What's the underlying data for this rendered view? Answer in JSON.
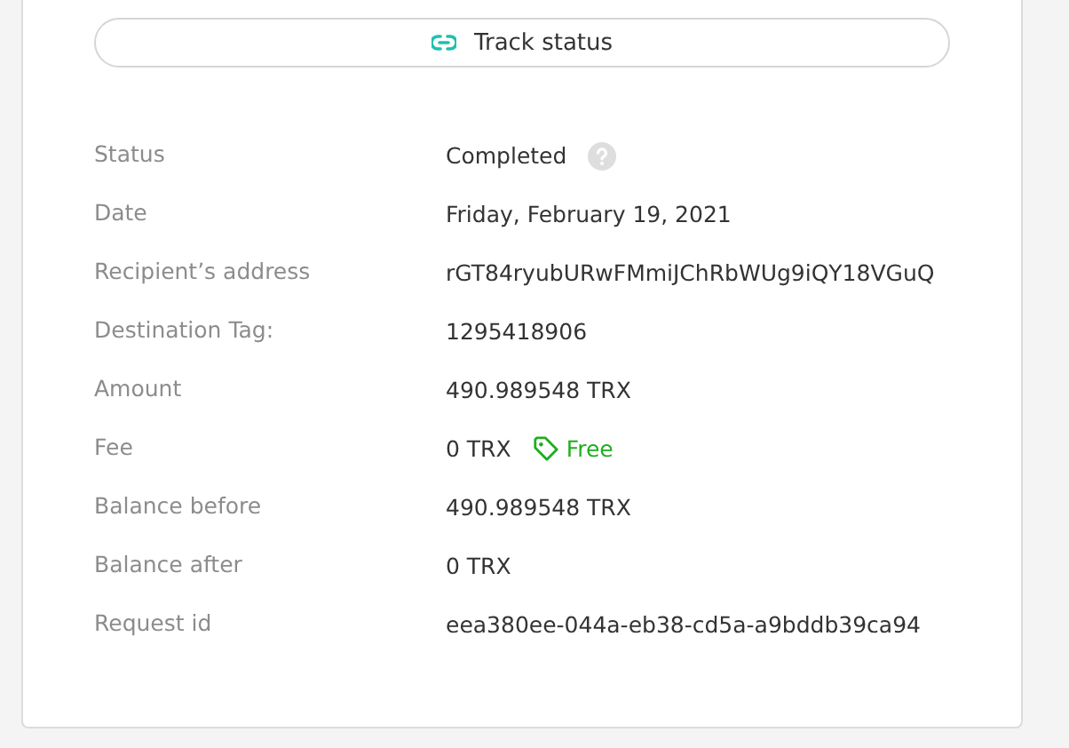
{
  "track_button": {
    "label": "Track status"
  },
  "details": [
    {
      "label": "Status",
      "value": "Completed",
      "kind": "help"
    },
    {
      "label": "Date",
      "value": "Friday, February 19, 2021",
      "kind": "plain"
    },
    {
      "label": "Recipient’s address",
      "value": "rGT84ryubURwFMmiJChRbWUg9iQY18VGuQ",
      "kind": "plain"
    },
    {
      "label": "Destination Tag:",
      "value": "1295418906",
      "kind": "plain"
    },
    {
      "label": "Amount",
      "value": "490.989548 TRX",
      "kind": "plain"
    },
    {
      "label": "Fee",
      "value": "0 TRX",
      "kind": "tag",
      "tag": "Free"
    },
    {
      "label": "Balance before",
      "value": "490.989548 TRX",
      "kind": "plain"
    },
    {
      "label": "Balance after",
      "value": "0 TRX",
      "kind": "plain"
    },
    {
      "label": "Request id",
      "value": "eea380ee-044a-eb38-cd5a-a9bddb39ca94",
      "kind": "plain"
    }
  ]
}
